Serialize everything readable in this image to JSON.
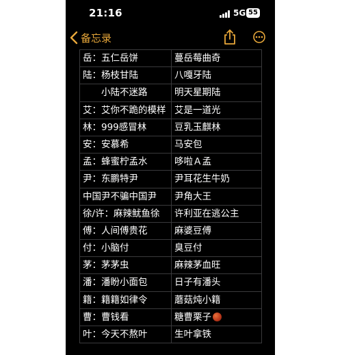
{
  "status_bar": {
    "time": "21:16",
    "network": "5G",
    "battery": "55"
  },
  "nav": {
    "back_label": "备忘录"
  },
  "table": {
    "rows": [
      {
        "left": "岳：五仁岳饼",
        "right": "蔓岳莓曲奇"
      },
      {
        "left": "陆：杨枝甘陆",
        "right": "八嘎牙陆"
      },
      {
        "left": "　　小陆不迷路",
        "right": "明天星期陆"
      },
      {
        "left": "艾：艾你不跪的模样",
        "right": "艾是一道光"
      },
      {
        "left": "林：999感冒林",
        "right": "豆乳玉麒林"
      },
      {
        "left": "安：安慕希",
        "right": "马安包"
      },
      {
        "left": "孟：蜂蜜柠孟水",
        "right": "哆啦Ａ孟"
      },
      {
        "left": "尹：东鹏特尹",
        "right": " 尹耳花生牛奶"
      },
      {
        "left": "中国尹不骗中国尹",
        "right": "尹角大王"
      },
      {
        "left": "徐/许：麻辣鱿鱼徐",
        "right": "许利亚在逃公主"
      },
      {
        "left": "傅：人间傅贵花",
        "right": "麻婆豆傅"
      },
      {
        "left": "付：小脑付",
        "right": "臭豆付"
      },
      {
        "left": "茅：茅茅虫",
        "right": "麻辣茅血旺"
      },
      {
        "left": "潘：潘盼小面包",
        "right": "日子有潘头"
      },
      {
        "left": "籍：籍籍如律令",
        "right": "蘑菇炖小籍"
      },
      {
        "left": "曹：曹钱看",
        "right": "糖曹栗子"
      },
      {
        "left": "叶：今天不熬叶",
        "right": "生叶拿铁"
      }
    ]
  },
  "colors": {
    "accent": "#e9a83a",
    "background": "#000000",
    "grid": "#3a3a3c"
  },
  "icons": [
    "back-chevron-icon",
    "share-icon",
    "more-icon",
    "signal-icon",
    "battery-icon",
    "basketball-icon"
  ]
}
